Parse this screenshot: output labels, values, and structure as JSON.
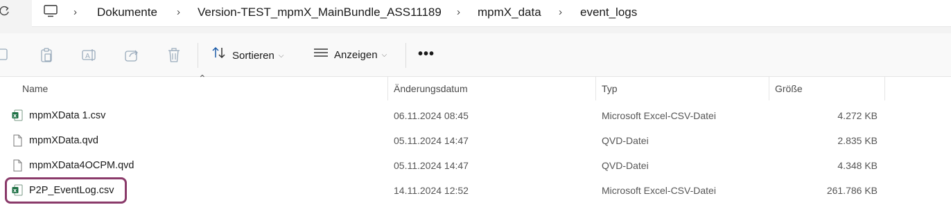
{
  "breadcrumb": {
    "items": [
      "Dokumente",
      "Version-TEST_mpmX_MainBundle_ASS11189",
      "mpmX_data",
      "event_logs"
    ]
  },
  "toolbar": {
    "sort_label": "Sortieren",
    "view_label": "Anzeigen",
    "more_label": "•••"
  },
  "columns": {
    "name": "Name",
    "date": "Änderungsdatum",
    "type": "Typ",
    "size": "Größe"
  },
  "files": [
    {
      "name": "mpmXData 1.csv",
      "date": "06.11.2024 08:45",
      "type": "Microsoft Excel-CSV-Datei",
      "size": "4.272 KB",
      "icon": "excel-csv-icon"
    },
    {
      "name": "mpmXData.qvd",
      "date": "05.11.2024 14:47",
      "type": "QVD-Datei",
      "size": "2.835 KB",
      "icon": "generic-file-icon"
    },
    {
      "name": "mpmXData4OCPM.qvd",
      "date": "05.11.2024 14:47",
      "type": "QVD-Datei",
      "size": "4.348 KB",
      "icon": "generic-file-icon"
    },
    {
      "name": "P2P_EventLog.csv",
      "date": "14.11.2024 12:52",
      "type": "Microsoft Excel-CSV-Datei",
      "size": "261.786 KB",
      "icon": "excel-csv-icon"
    }
  ],
  "colors": {
    "highlight": "#8a3a6a",
    "excel_green": "#1e7145"
  }
}
